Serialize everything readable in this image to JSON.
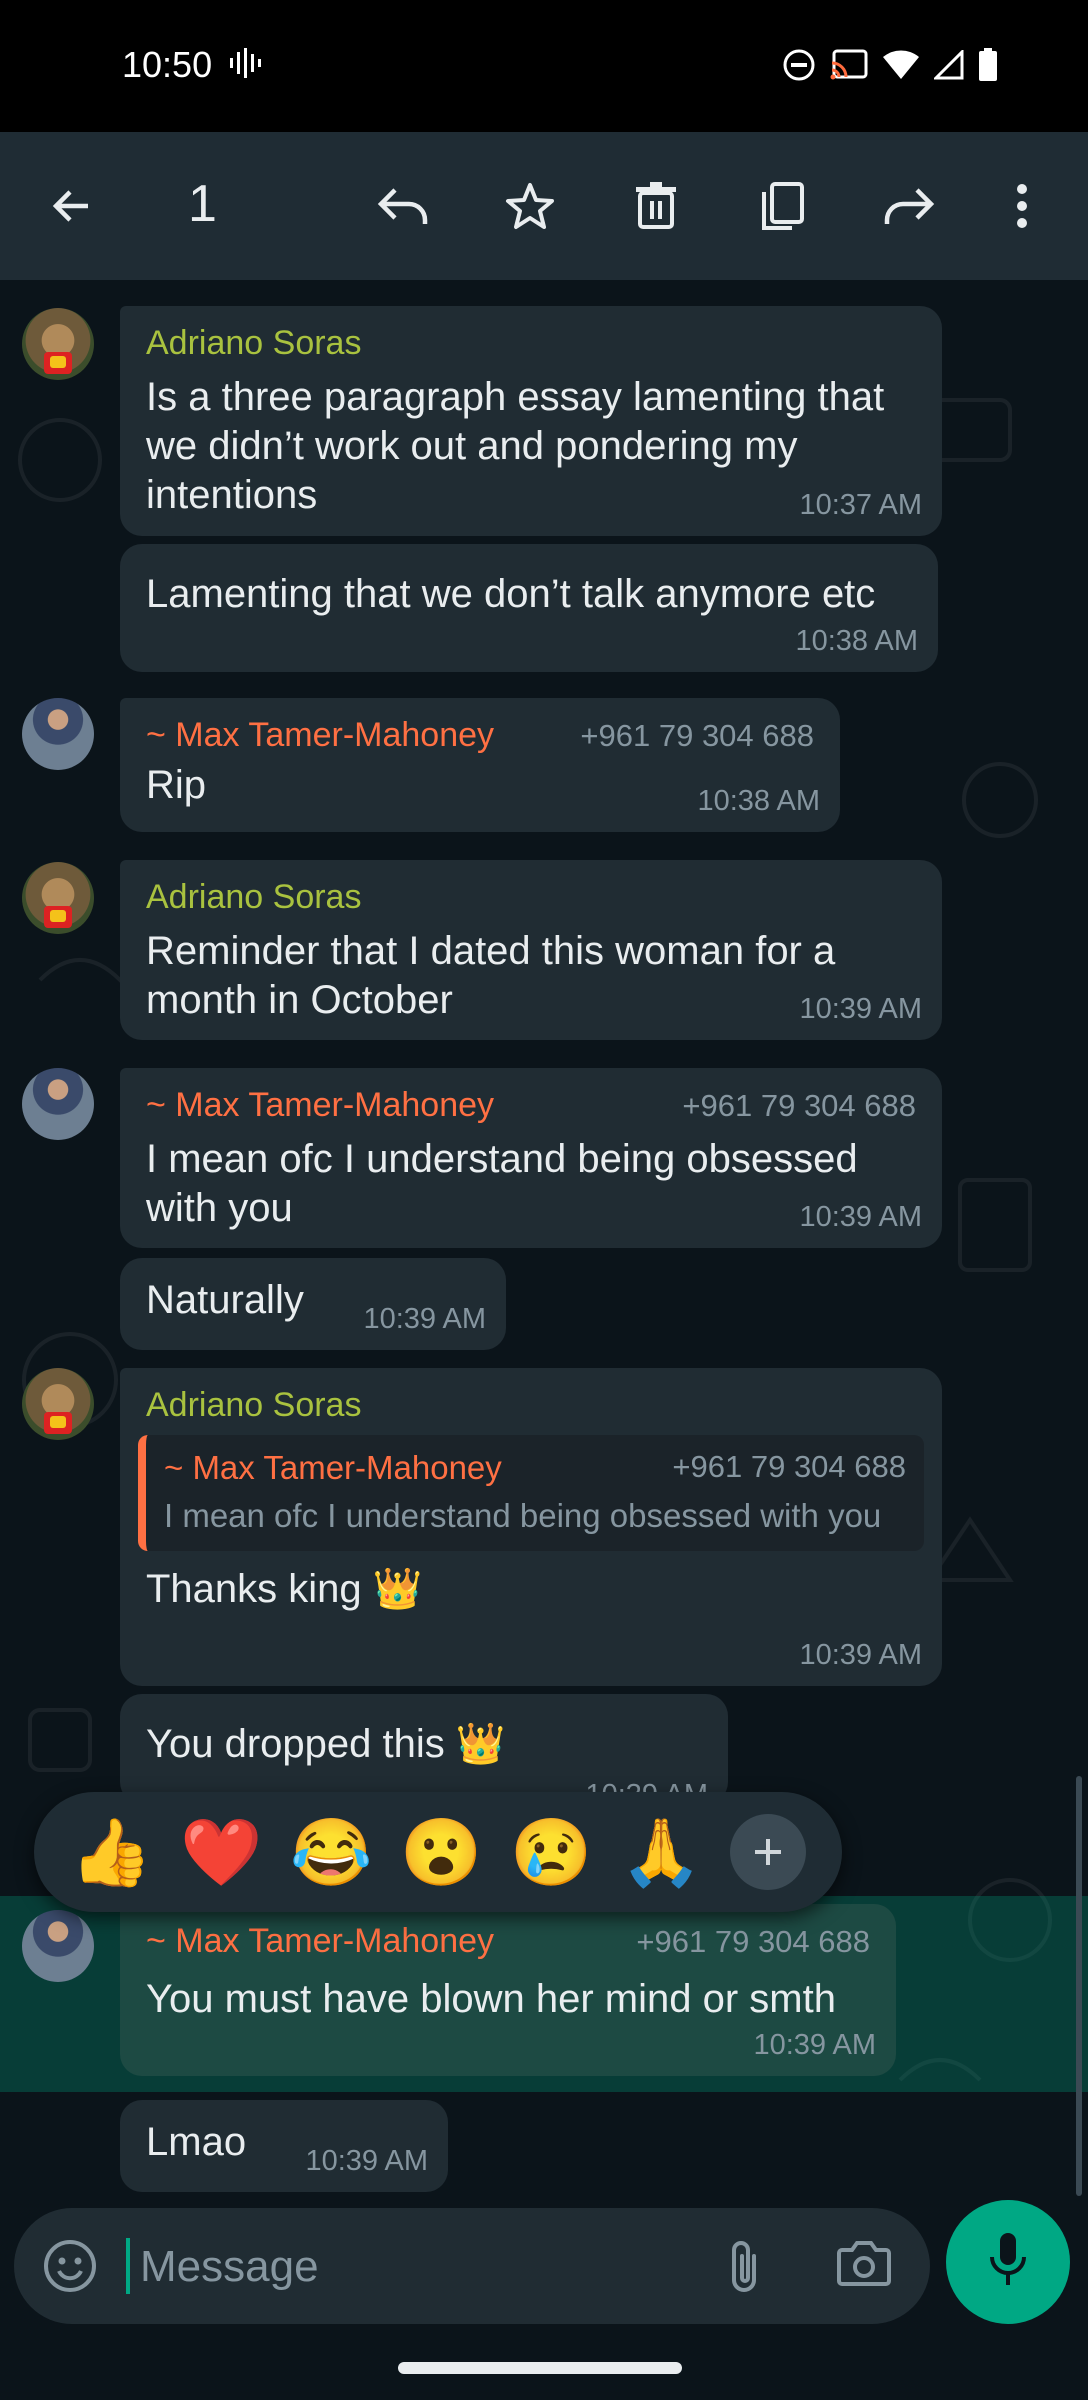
{
  "status_bar": {
    "time": "10:50"
  },
  "action_bar": {
    "selected_count": "1"
  },
  "messages": [
    {
      "sender": "Adriano Soras",
      "text": "Is a three paragraph essay lamenting that we didn’t work out and pondering my intentions",
      "time": "10:37 AM"
    },
    {
      "text": "Lamenting that we don’t talk anymore etc",
      "time": "10:38 AM"
    },
    {
      "sender": "~ Max Tamer-Mahoney",
      "phone": "+961 79 304 688",
      "text": "Rip",
      "time": "10:38 AM"
    },
    {
      "sender": "Adriano Soras",
      "text": "Reminder that I dated this woman for a month in October",
      "time": "10:39 AM"
    },
    {
      "sender": "~ Max Tamer-Mahoney",
      "phone": "+961 79 304 688",
      "text": "I mean ofc I understand being obsessed with you",
      "time": "10:39 AM"
    },
    {
      "text": "Naturally",
      "time": "10:39 AM"
    },
    {
      "sender": "Adriano Soras",
      "quote": {
        "sender": "~ Max Tamer-Mahoney",
        "phone": "+961 79 304 688",
        "text": "I mean ofc I understand being obsessed with you"
      },
      "text": "Thanks king 👑",
      "time": "10:39 AM"
    },
    {
      "text": "You dropped this 👑",
      "time": "10:39 AM"
    },
    {
      "sender": "~ Max Tamer-Mahoney",
      "phone": "+961 79 304 688",
      "text": "You must have blown her mind or smth",
      "time": "10:39 AM"
    },
    {
      "text": "Lmao",
      "time": "10:39 AM"
    }
  ],
  "reactions": [
    "👍",
    "❤️",
    "😂",
    "😮",
    "😢",
    "🙏"
  ],
  "composer": {
    "placeholder": "Message"
  },
  "colors": {
    "accent": "#00a884",
    "bubble": "#202c33",
    "background": "#0b141a",
    "sender_green": "#a9c23f",
    "sender_orange": "#ff7043"
  },
  "icons": [
    "back-arrow-icon",
    "reply-icon",
    "star-icon",
    "delete-icon",
    "copy-icon",
    "forward-icon",
    "more-vert-icon",
    "emoji-icon",
    "attach-icon",
    "camera-icon",
    "mic-icon",
    "plus-icon"
  ]
}
